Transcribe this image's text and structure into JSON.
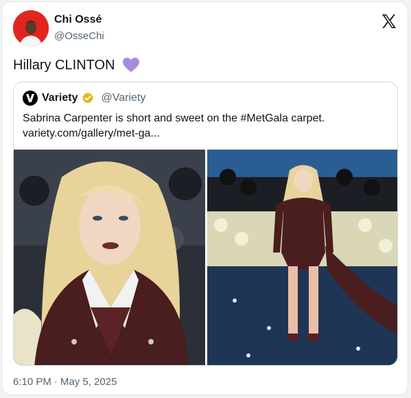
{
  "author": {
    "display_name": "Chi Ossé",
    "handle": "@OsseChi",
    "avatar_icon": "profile-photo",
    "avatar_color": "#e2261f"
  },
  "platform_icon": "x-logo-icon",
  "tweet": {
    "text": "Hillary CLINTON",
    "emoji": "purple-heart",
    "emoji_color": "#a78bdb"
  },
  "quoted": {
    "display_name": "Variety",
    "handle": "@Variety",
    "verified_color": "#e8b417",
    "text_line1": "Sabrina Carpenter is short and sweet on the #MetGala carpet.",
    "text_line2": "variety.com/gallery/met-ga..."
  },
  "timestamp": {
    "time": "6:10 PM",
    "separator": "·",
    "date": "May 5, 2025"
  }
}
